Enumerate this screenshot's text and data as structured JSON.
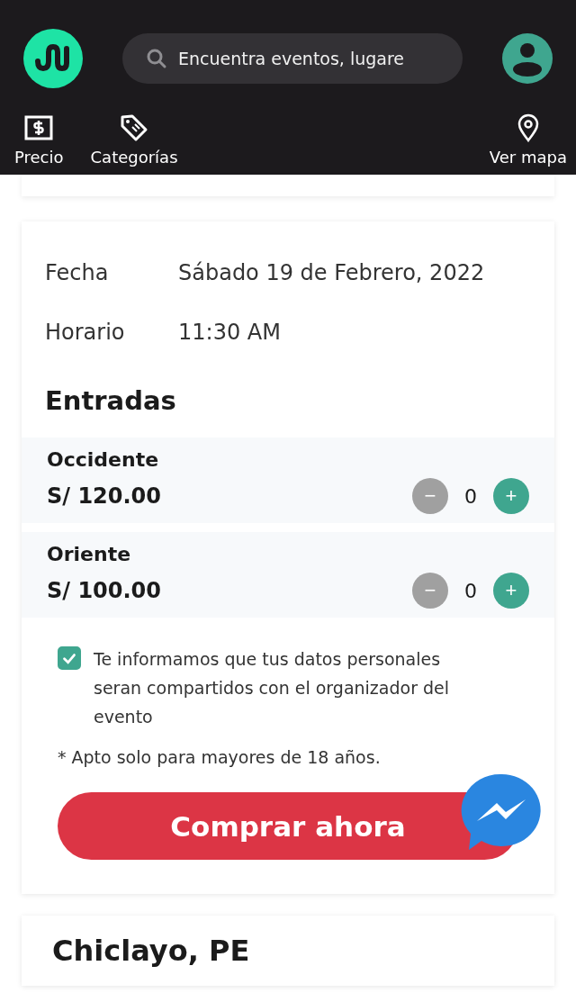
{
  "header": {
    "search": {
      "placeholder": "Encuentra eventos, lugare"
    },
    "nav": [
      {
        "label": "Precio",
        "kind": "price"
      },
      {
        "label": "Categorías",
        "kind": "tag"
      },
      {
        "label": "Ver mapa",
        "kind": "map"
      }
    ]
  },
  "details": [
    {
      "label": "Fecha",
      "value": "Sábado 19 de Febrero, 2022"
    },
    {
      "label": "Horario",
      "value": "11:30 AM"
    }
  ],
  "tickets_title": "Entradas",
  "tickets": [
    {
      "name": "Occidente",
      "price": "S/ 120.00",
      "minus": "−",
      "minus_disabled": true,
      "quantity": "0",
      "plus": "+"
    },
    {
      "name": "Oriente",
      "price": "S/ 100.00",
      "minus": "−",
      "minus_disabled": true,
      "quantity": "0",
      "plus": "+"
    }
  ],
  "consent": {
    "checked": true,
    "text": "Te informamos que tus datos personales seran compartidos con el organizador del evento"
  },
  "age_note": "* Apto solo para mayores de 18 años.",
  "buy_button": "Comprar ahora",
  "location_title": "Chiclayo, PE"
}
